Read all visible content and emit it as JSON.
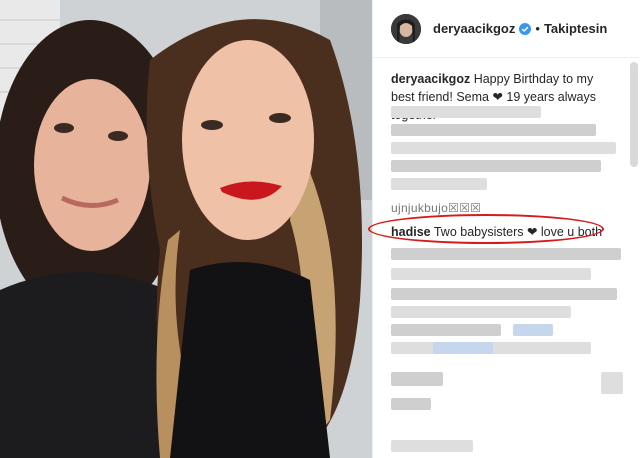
{
  "post": {
    "username": "deryaacikgoz",
    "verified_icon": "verified-badge-icon",
    "separator": "•",
    "follow_status": "Takiptesin",
    "caption_text": "Happy Birthday to my best friend! Sema ❤ 19 years always together"
  },
  "comments": {
    "partial_text": "ujnjukbujo☒☒☒",
    "highlighted": {
      "username": "hadise",
      "text": "Two babysisters ❤ love u both"
    }
  },
  "colors": {
    "highlight_circle": "#d41c1c",
    "verified_blue": "#3897f0",
    "lipstick": "#c8181e"
  }
}
